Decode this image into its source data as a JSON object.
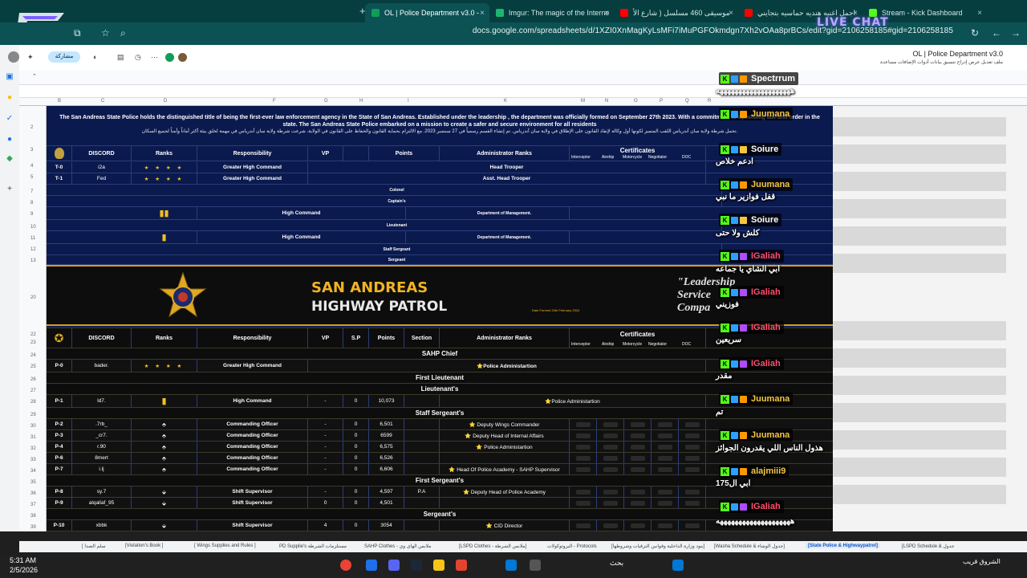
{
  "browser": {
    "tabs": [
      {
        "label": "Stream - Kick Dashboard",
        "color": "#53fc18"
      },
      {
        "label": "اجمل اغنيه هنديه حماسيه بتجايني",
        "color": "#ff0000"
      },
      {
        "label": "موسيقى 460 مسلسل ( شارع الأ",
        "color": "#ff0000"
      },
      {
        "label": "Imgur: The magic of the Interne",
        "color": "#1bb76e"
      },
      {
        "label": "OL | Police Department v3.0 - ",
        "color": "#0f9d58",
        "active": true
      }
    ],
    "url": "docs.google.com/spreadsheets/d/1XZI0XnMagKyLsMFi7iMuPGFOkmdgn7Xh2vOAa8prBCs/edit?gid=2106258185#gid=2106258185",
    "share_label": "مشاركة"
  },
  "sheet_header": {
    "title": "OL | Police Department v3.0",
    "menu": "ملف  تعديل  عرض  إدراج  تنسيق  بيانات  أدوات  الإضافات  مساعدة"
  },
  "intro": {
    "en": "The San Andreas State Police holds the distinguished title of being the first-ever law enforcement agency in the State of San Andreas. Established under the leadership , the department was officially formed on September 27th 2023. With a commitment to upholding law and order in the state. The San Andreas State Police embarked on a mission to create a safer and secure environment for all residents",
    "ar": "تحمل شرطة ولاية سان أندرياس اللقب المتميز لكونها أول وكالة لإنفاذ القانون على الإطلاق في ولاية سان أندرياس. تم إنشاء القسم رسمياً في 27 سبتمبر 2023. مع الالتزام بحماية القانون والحفاظ على القانون في الولاية. شرعت شرطة ولاية سان أندرياس في مهمة لخلق بيئة أكثر أماناً وأمناً لجميع السكان."
  },
  "columns": {
    "discord": "DISCORD",
    "ranks": "Ranks",
    "responsibility": "Responsibility",
    "vp": "VP",
    "sp": "S.P",
    "points": "Points",
    "section": "Section",
    "admin_ranks": "Administrator Ranks",
    "certificates": "Certificates",
    "cert_items": [
      "Interceptor",
      "Airship",
      "Motorcycle",
      "Negotiator",
      "DOC"
    ]
  },
  "state_rows": [
    {
      "id": "T-0",
      "discord": "i2a",
      "stars": "★ ★ ★ ★",
      "resp": "Greater High Command",
      "admin": "Head Trooper"
    },
    {
      "id": "T-1",
      "discord": "Fed",
      "stars": "★ ★ ★ ★",
      "resp": "Greater High Command",
      "admin": "Asst. Head Trooper"
    }
  ],
  "state_sections": {
    "colonel": "Colonel",
    "captains": "Captain's",
    "high_command_1": "High Command",
    "dept_mgmt_1": "Department of Management.",
    "lieutenant": "Lieutenant",
    "high_command_2": "High Command",
    "dept_mgmt_2": "Department of Management.",
    "staff_sergeant": "Staff Sergeant",
    "sergeant": "Sergeant"
  },
  "banner": {
    "line1": "SAN ANDREAS",
    "line2": "HIGHWAY PATROL",
    "formed": "Date Formed 24th February 2024",
    "motto_1": "\"Leadership",
    "motto_2": "Service",
    "motto_3": "Compa"
  },
  "sahp": {
    "chief_title": "SAHP Chief",
    "chief": {
      "id": "P-0",
      "discord": "bader.",
      "stars": "★ ★ ★ ★",
      "resp": "Greater High Command",
      "admin": "⭐Police Administartion"
    },
    "first_lt_title": "First Lieutenant",
    "lt_title": "Lieutenant's",
    "lt": {
      "id": "P-1",
      "discord": "ld7.",
      "resp": "High Command",
      "vp": "-",
      "sp": "0",
      "points": "10,073",
      "admin": "⭐Police Administartion"
    },
    "staff_sgt_title": "Staff Sergeant's",
    "staff_sgts": [
      {
        "id": "P-2",
        "discord": ".7rb_",
        "resp": "Commanding Officer",
        "vp": "-",
        "sp": "0",
        "points": "6,501",
        "admin": "⭐ Deputy Wings Commander"
      },
      {
        "id": "P-3",
        "discord": "_cr7.",
        "resp": "Commanding Officer",
        "vp": "-",
        "sp": "0",
        "points": "6599",
        "admin": "⭐ Deputy Head of Internal Affairs"
      },
      {
        "id": "P-4",
        "discord": "r.90",
        "resp": "Commanding Officer",
        "vp": "-",
        "sp": "0",
        "points": "6,575",
        "admin": "⭐ Police Administartion"
      },
      {
        "id": "P-6",
        "discord": "8mert",
        "resp": "Commanding Officer",
        "vp": "-",
        "sp": "0",
        "points": "6,526",
        "admin": ""
      },
      {
        "id": "P-7",
        "discord": "i.lj",
        "resp": "Commanding Officer",
        "vp": "-",
        "sp": "0",
        "points": "6,606",
        "admin": "⭐ Head Of Police Academy - SAHP Supervisor"
      }
    ],
    "first_sgt_title": "First Sergeant's",
    "first_sgts": [
      {
        "id": "P-8",
        "discord": "sy.7",
        "resp": "Shift Supervisor",
        "vp": "-",
        "sp": "0",
        "points": "4,597",
        "section": "P.A",
        "admin": "⭐ Deputy Head of Police Academy"
      },
      {
        "id": "P-9",
        "discord": "alqallaf_95",
        "resp": "Shift Supervisor",
        "vp": "0",
        "sp": "0",
        "points": "4,501",
        "section": "",
        "admin": ""
      }
    ],
    "sgt_title": "Sergeant's",
    "sgts": [
      {
        "id": "P-10",
        "discord": "xbbk",
        "resp": "Shift Supervisor",
        "vp": "4",
        "sp": "0",
        "points": "3054",
        "section": "",
        "admin": "⭐ CID Director"
      }
    ]
  },
  "chat": {
    "logo": "LIVE CHAT",
    "separator": "ههههههههههههههههههههه",
    "messages": [
      {
        "user": "Spectrrum",
        "color": "#ffffff",
        "text": "ههههههههههههههههههههه",
        "badge": "#ff9800"
      },
      {
        "user": "Juumana",
        "color": "#f5c542",
        "text": "",
        "badge": "#ff9800"
      },
      {
        "user": "Soiure",
        "color": "#ffffff",
        "text": "ادعم خلاص",
        "badge": "#f5c542"
      },
      {
        "user": "Juumana",
        "color": "#f5c542",
        "text": "قفل فوازير ما نبي",
        "badge": "#ff9800"
      },
      {
        "user": "Soiure",
        "color": "#ffffff",
        "text": "كلش ولا حتى",
        "badge": "#f5c542"
      },
      {
        "user": "IGaliah",
        "color": "#ff4d6d",
        "text": "ابي الشاي يا جماعه",
        "badge": "#b04bff"
      },
      {
        "user": "IGaliah",
        "color": "#ff4d6d",
        "text": "فوزيني",
        "badge": "#b04bff"
      },
      {
        "user": "IGaliah",
        "color": "#ff4d6d",
        "text": "سريعين",
        "badge": "#b04bff"
      },
      {
        "user": "IGaliah",
        "color": "#ff4d6d",
        "text": "مقدر",
        "badge": "#b04bff"
      },
      {
        "user": "Juumana",
        "color": "#f5c542",
        "text": "تم",
        "badge": "#ff9800"
      },
      {
        "user": "Juumana",
        "color": "#f5c542",
        "text": "هذول الناس اللي يقدرون الجوائز",
        "badge": "#ff9800"
      },
      {
        "user": "alajmiii9",
        "color": "#f5c542",
        "text": "ابي ال175",
        "badge": "#ff9800"
      },
      {
        "user": "IGaliah",
        "color": "#ff4d6d",
        "text": "ههههههههههههههههههههه",
        "badge": "#b04bff"
      }
    ]
  },
  "sheet_tabs": [
    "[State Police & Highwaypatrol]",
    "[LSPD Schedule & جدول",
    "[Washa Schedule & جدول الوشاء]",
    "[بنود وزارة الداخلية وقوانين الترقيات وشروطها]",
    "البروتوكولات - Protocols",
    "[LSPD Clothes - ملابس الشرطة]",
    "SAHP Clothes - ملابس الهاي وي",
    "PD Supplie's مستلزمات الشرطة",
    "[ Wings Supplies and Rules ]",
    "[Violation's Book ]",
    "[ سلم الصدا"
  ],
  "taskbar": {
    "time": "5:31 AM",
    "date": "2/5/2026",
    "search": "بحث",
    "weather": "الشروق قريب"
  },
  "colors": {
    "sheet_bg": "#0b1a4e",
    "gold": "#f0c020",
    "kick_green": "#53fc18"
  }
}
